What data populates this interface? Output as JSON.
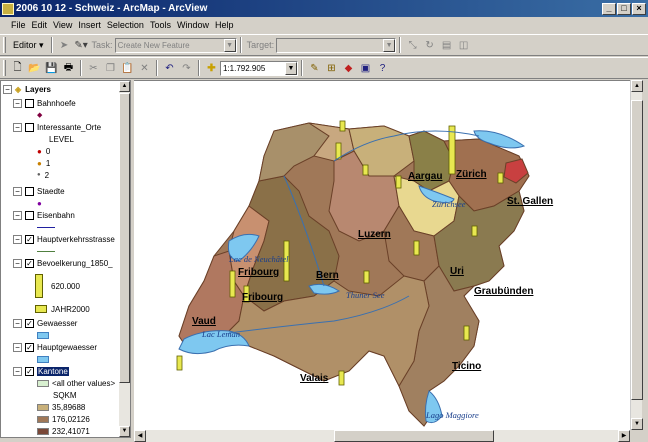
{
  "window": {
    "title": "2006 10 12 - Schweiz - ArcMap - ArcView"
  },
  "menu": [
    "File",
    "Edit",
    "View",
    "Insert",
    "Selection",
    "Tools",
    "Window",
    "Help"
  ],
  "editor_toolbar": {
    "editor_label": "Editor",
    "task_label": "Task:",
    "task_value": "Create New Feature",
    "target_label": "Target:",
    "target_value": ""
  },
  "standard_toolbar": {
    "scale_value": "1:1.792.905"
  },
  "toc": {
    "root_label": "Layers",
    "layers": [
      {
        "name": "Bahnhoefe",
        "checked": false
      },
      {
        "name": "Interessante_Orte",
        "checked": false,
        "field": "LEVEL",
        "classes": [
          "0",
          "1",
          "2"
        ]
      },
      {
        "name": "Staedte",
        "checked": false
      },
      {
        "name": "Eisenbahn",
        "checked": false
      },
      {
        "name": "Hauptverkehrsstrasse",
        "checked": true
      },
      {
        "name": "Bevoelkerung_1850_",
        "checked": true,
        "value": "620.000",
        "field": "JAHR2000"
      },
      {
        "name": "Gewaesser",
        "checked": true
      },
      {
        "name": "Hauptgewaesser",
        "checked": true
      },
      {
        "name": "Kantone",
        "checked": true,
        "classes": [
          "<all other values>",
          "SQKM",
          "35,89688",
          "176,02126",
          "232,41071"
        ]
      }
    ]
  },
  "map": {
    "cantons": [
      "Aargau",
      "Zürich",
      "St. Gallen",
      "Luzern",
      "Bern",
      "Fribourg",
      "Fribourg",
      "Vaud",
      "Uri",
      "Graubünden",
      "Valais",
      "Ticino"
    ],
    "lakes": [
      "Lac de Neuchâtel",
      "Zürichsee",
      "Thuner See",
      "Lac Leman",
      "Lago Maggiore"
    ],
    "colors": {
      "background": "#ffffff",
      "lake": "#7ec8f0",
      "canton_light": "#c8b07a",
      "canton_mid": "#a07858",
      "canton_dark": "#7a4838",
      "canton_olive": "#8a8048",
      "border": "#8a5a3c",
      "bar_fill": "#e8e850"
    }
  }
}
